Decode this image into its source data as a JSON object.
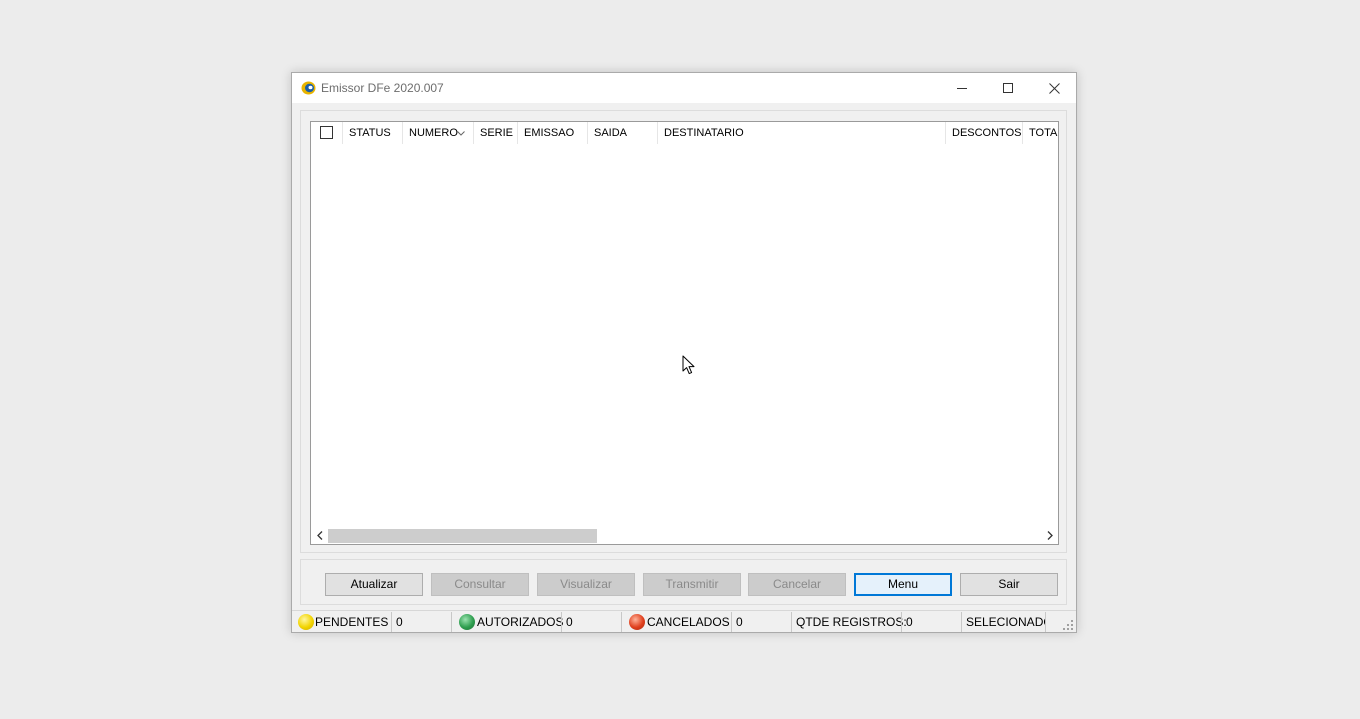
{
  "window": {
    "title": "Emissor DFe 2020.007",
    "controls": {
      "minimize": "minimize-icon",
      "maximize": "maximize-icon",
      "close": "close-icon"
    }
  },
  "grid": {
    "columns": [
      "STATUS",
      "NUMERO",
      "SERIE",
      "EMISSAO",
      "SAIDA",
      "DESTINATARIO",
      "DESCONTOS",
      "TOTAL"
    ],
    "rows": [],
    "sorted_column": "NUMERO",
    "scrollbar": {
      "position": 0
    }
  },
  "buttons": {
    "atualizar": "Atualizar",
    "consultar": "Consultar",
    "visualizar": "Visualizar",
    "transmitir": "Transmitir",
    "cancelar": "Cancelar",
    "menu": "Menu",
    "sair": "Sair"
  },
  "statusbar": {
    "pendentes_label": "PENDENTES",
    "pendentes_count": "0",
    "autorizados_label": "AUTORIZADOS",
    "autorizados_count": "0",
    "cancelados_label": "CANCELADOS",
    "cancelados_count": "0",
    "qtde_label": "QTDE REGISTROS:",
    "qtde_count": "0",
    "selecionados_label": "SELECIONADOS"
  },
  "colors": {
    "pendentes": "#f2d400",
    "autorizados": "#2e9e4f",
    "cancelados": "#e0401e",
    "focus_accent": "#0078d7"
  }
}
